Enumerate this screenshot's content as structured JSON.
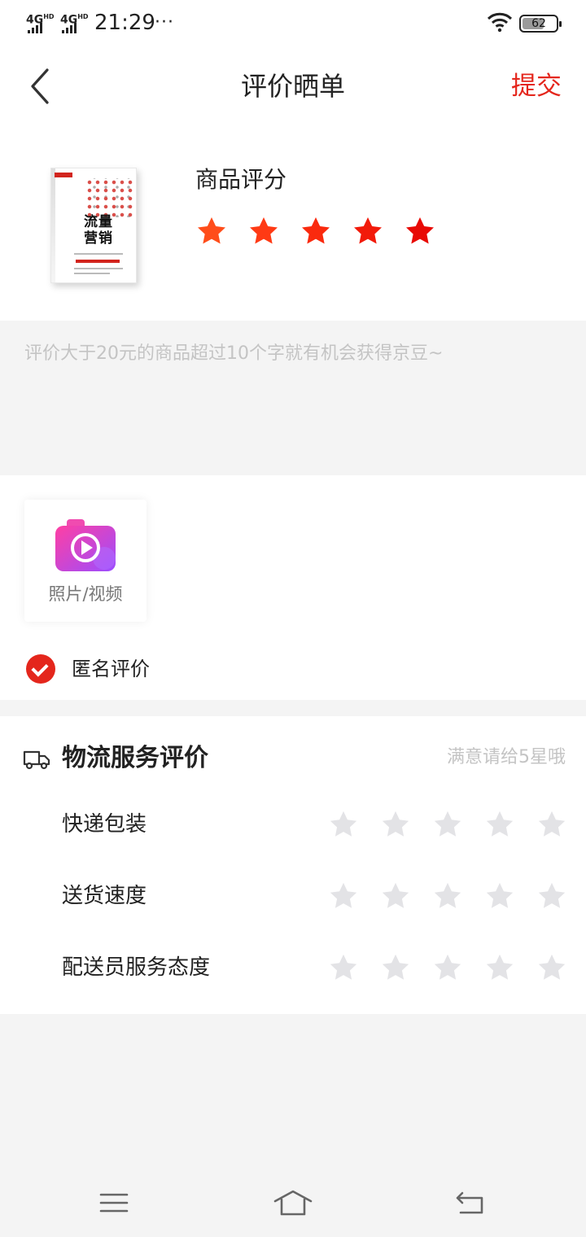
{
  "status_bar": {
    "network1": "4G",
    "network1_sup": "HD",
    "network2": "4G",
    "network2_sup": "HD",
    "time": "21:29",
    "more": "···",
    "battery": "62"
  },
  "header": {
    "title": "评价晒单",
    "submit_label": "提交"
  },
  "product": {
    "cover_title": "流量营销",
    "rating_label": "商品评分",
    "rating": 5,
    "star_colors": [
      "#ff4d1a",
      "#ff3a14",
      "#fa2a0e",
      "#f21a0a",
      "#e80a05"
    ]
  },
  "comment": {
    "placeholder": "评价大于20元的商品超过10个字就有机会获得京豆~",
    "value": ""
  },
  "media": {
    "upload_label": "照片/视频",
    "anonymous_label": "匿名评价",
    "anonymous_checked": true
  },
  "logistics": {
    "title": "物流服务评价",
    "hint": "满意请给5星哦",
    "star_color_empty": "#e3e3e6",
    "items": [
      {
        "label": "快递包装",
        "rating": 0
      },
      {
        "label": "送货速度",
        "rating": 0
      },
      {
        "label": "配送员服务态度",
        "rating": 0
      }
    ]
  },
  "colors": {
    "accent": "#e4261c",
    "camera_gradient_start": "#ff3fa3",
    "camera_gradient_end": "#9b4dff"
  },
  "icons": {
    "back": "chevron-left-icon",
    "camera": "video-camera-icon",
    "truck": "truck-icon",
    "menu": "menu-icon",
    "home": "home-icon",
    "return": "return-icon"
  }
}
